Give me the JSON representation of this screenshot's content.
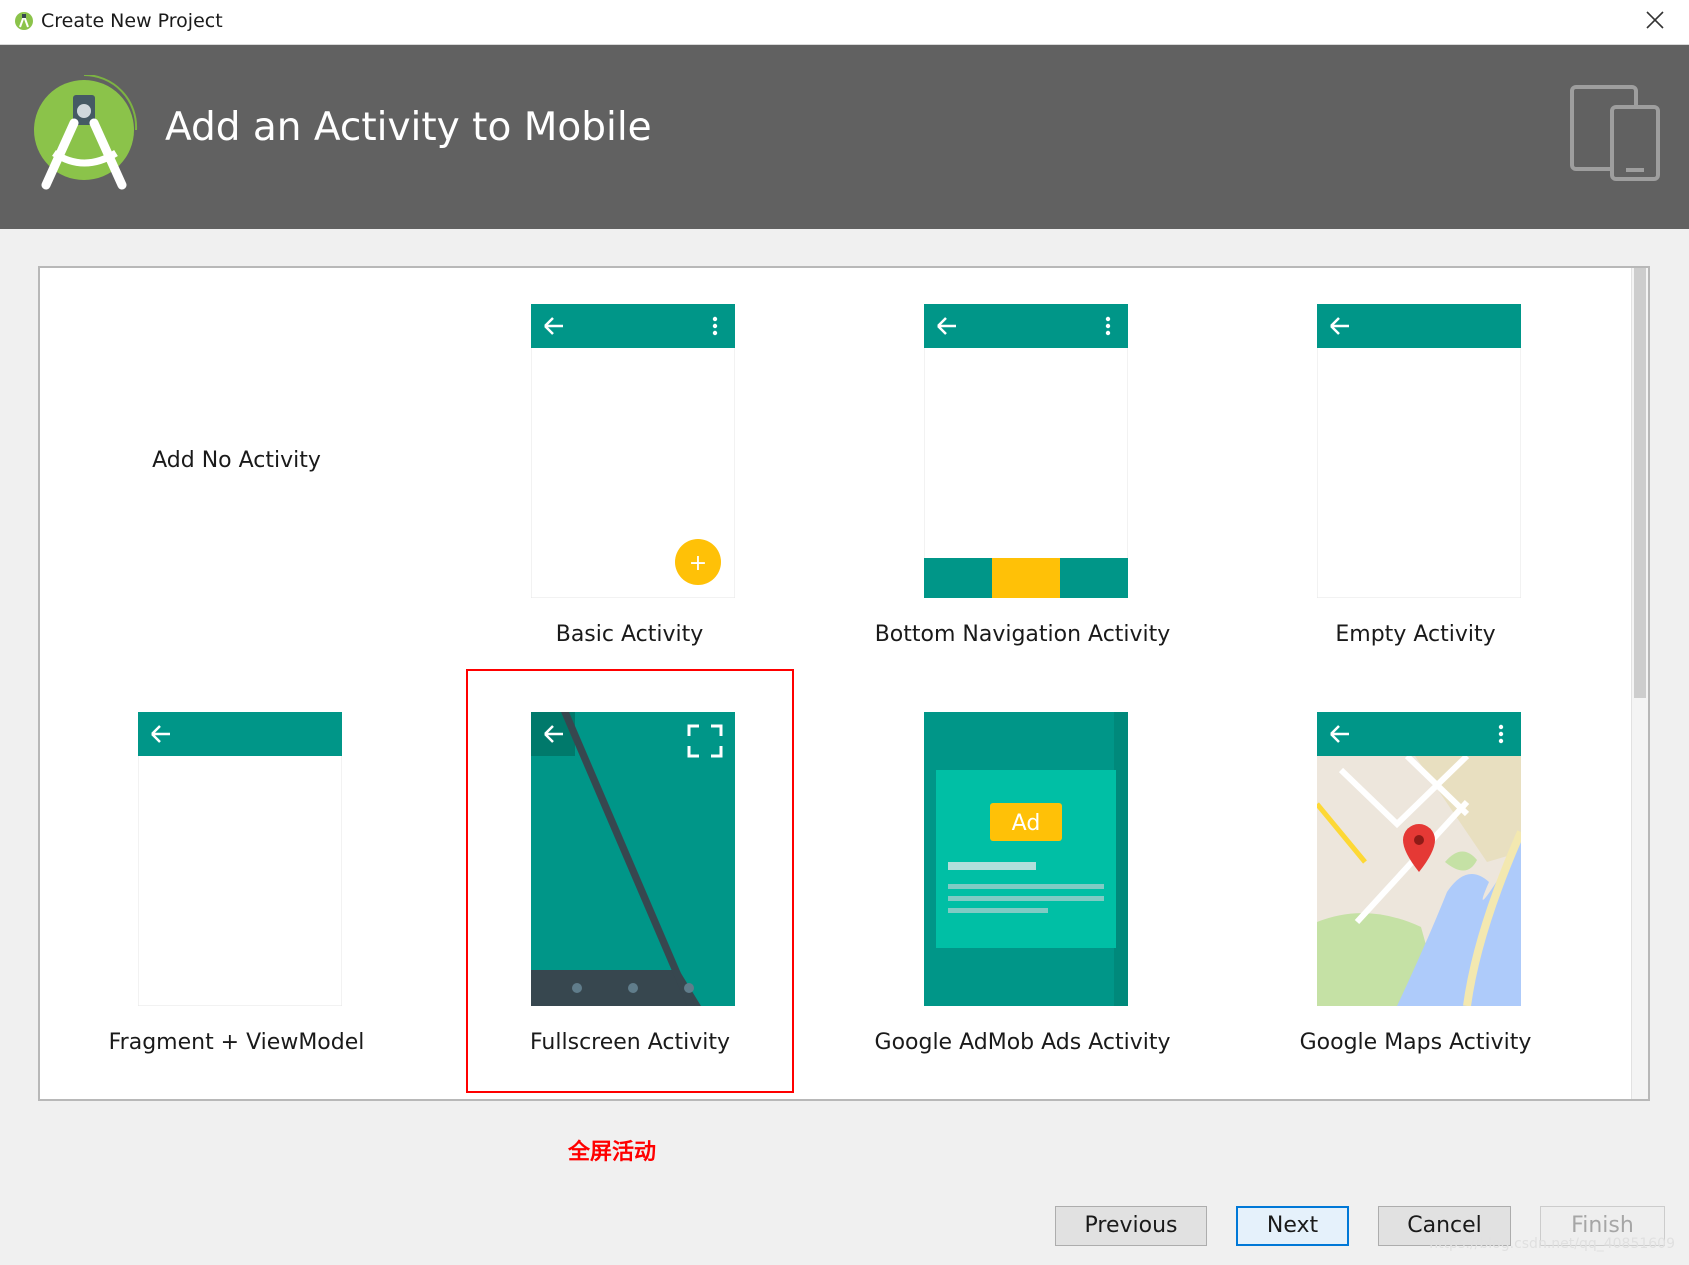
{
  "window": {
    "title": "Create New Project",
    "close_glyph": "✕"
  },
  "header": {
    "title": "Add an Activity to Mobile"
  },
  "gallery": {
    "items": [
      {
        "label": "Add No Activity"
      },
      {
        "label": "Basic Activity",
        "fab_glyph": "+"
      },
      {
        "label": "Bottom Navigation Activity"
      },
      {
        "label": "Empty Activity"
      },
      {
        "label": "Fragment + ViewModel"
      },
      {
        "label": "Fullscreen Activity"
      },
      {
        "label": "Google AdMob Ads Activity",
        "ad_text": "Ad"
      },
      {
        "label": "Google Maps Activity"
      }
    ],
    "selected_label": "Fullscreen Activity"
  },
  "annotation": {
    "text": "全屏活动"
  },
  "buttons": {
    "previous": "Previous",
    "next": "Next",
    "cancel": "Cancel",
    "finish": "Finish"
  },
  "watermark": "https://blog.csdn.net/qq_40851609",
  "colors": {
    "teal": "#009688",
    "teal_light": "#00bfa5",
    "fab_amber": "#ffc107",
    "header_bg": "#616161",
    "android_green": "#8bc34a",
    "selection_red": "#ff0000",
    "focus_blue": "#0078d7"
  },
  "icons": {
    "app": "android-studio-icon",
    "logo": "android-studio-logo",
    "devices": "phone-tablet-icon",
    "back": "back-arrow-icon",
    "overflow": "overflow-menu-icon",
    "fullscreen": "fullscreen-icon",
    "map_pin": "map-pin-icon"
  }
}
